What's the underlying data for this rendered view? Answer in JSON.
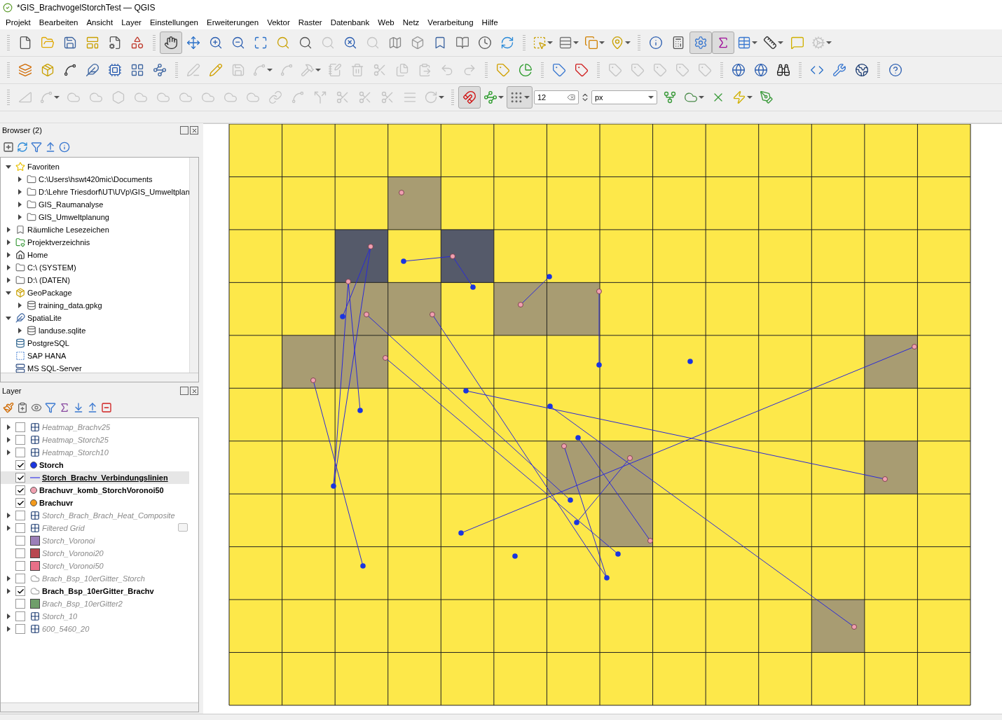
{
  "window": {
    "title": "*GIS_BrachvogelStorchTest — QGIS"
  },
  "menu": [
    "Projekt",
    "Bearbeiten",
    "Ansicht",
    "Layer",
    "Einstellungen",
    "Erweiterungen",
    "Vektor",
    "Raster",
    "Datenbank",
    "Web",
    "Netz",
    "Verarbeitung",
    "Hilfe"
  ],
  "snapping": {
    "tolerance": "12",
    "unit": "px"
  },
  "browser": {
    "title": "Browser (2)",
    "items": [
      {
        "label": "Favoriten",
        "kind": "star",
        "expandable": true,
        "expanded": true,
        "children": [
          {
            "label": "C:\\Users\\hswt420mic\\Documents",
            "kind": "folder",
            "expandable": true,
            "expanded": false
          },
          {
            "label": "D:\\Lehre Triesdorf\\UT\\UVp\\GIS_Umweltplan",
            "kind": "folder",
            "expandable": true,
            "expanded": false
          },
          {
            "label": "GIS_Raumanalyse",
            "kind": "folder",
            "expandable": true,
            "expanded": false
          },
          {
            "label": "GIS_Umweltplanung",
            "kind": "folder",
            "expandable": true,
            "expanded": false
          }
        ]
      },
      {
        "label": "Räumliche Lesezeichen",
        "kind": "bookmark",
        "expandable": true,
        "expanded": false
      },
      {
        "label": "Projektverzeichnis",
        "kind": "project",
        "expandable": true,
        "expanded": false
      },
      {
        "label": "Home",
        "kind": "home",
        "expandable": true,
        "expanded": false
      },
      {
        "label": "C:\\ (SYSTEM)",
        "kind": "folder",
        "expandable": true,
        "expanded": false
      },
      {
        "label": "D:\\ (DATEN)",
        "kind": "folder",
        "expandable": true,
        "expanded": false
      },
      {
        "label": "GeoPackage",
        "kind": "geopackage",
        "expandable": true,
        "expanded": true,
        "children": [
          {
            "label": "training_data.gpkg",
            "kind": "database",
            "expandable": true,
            "expanded": false
          }
        ]
      },
      {
        "label": "SpatiaLite",
        "kind": "spatialite",
        "expandable": true,
        "expanded": true,
        "children": [
          {
            "label": "landuse.sqlite",
            "kind": "database",
            "expandable": true,
            "expanded": false
          }
        ]
      },
      {
        "label": "PostgreSQL",
        "kind": "postgres",
        "expandable": false
      },
      {
        "label": "SAP HANA",
        "kind": "hana",
        "expandable": false
      },
      {
        "label": "MS SQL-Server",
        "kind": "mssql",
        "expandable": false
      }
    ]
  },
  "layers": {
    "title": "Layer",
    "items": [
      {
        "label": "Heatmap_Brachv25",
        "kind": "raster",
        "checked": false,
        "expandable": true,
        "selected": false,
        "filtered": false
      },
      {
        "label": "Heatmap_Storch25",
        "kind": "raster",
        "checked": false,
        "expandable": true,
        "selected": false,
        "filtered": false
      },
      {
        "label": "Heatmap_Storch10",
        "kind": "raster",
        "checked": false,
        "expandable": true,
        "selected": false,
        "filtered": false
      },
      {
        "label": "Storch",
        "kind": "point",
        "color": "#1a35e0",
        "checked": true,
        "expandable": false,
        "selected": false,
        "filtered": false
      },
      {
        "label": "Storch_Brachv_Verbindungslinien",
        "kind": "line",
        "color": "#7f7fe8",
        "checked": true,
        "expandable": false,
        "selected": true,
        "filtered": false
      },
      {
        "label": "Brachuvr_komb_StorchVoronoi50",
        "kind": "point",
        "color": "#f0a0b0",
        "checked": true,
        "expandable": false,
        "selected": false,
        "filtered": false
      },
      {
        "label": "Brachuvr",
        "kind": "point",
        "color": "#f39a1c",
        "checked": true,
        "expandable": false,
        "selected": false,
        "filtered": false
      },
      {
        "label": "Storch_Brach_Brach_Heat_Composite",
        "kind": "raster",
        "checked": false,
        "expandable": true,
        "selected": false,
        "filtered": false
      },
      {
        "label": "Filtered Grid",
        "kind": "raster",
        "checked": false,
        "expandable": true,
        "selected": false,
        "filtered": true
      },
      {
        "label": "Storch_Voronoi",
        "kind": "fill",
        "color": "#9b7fb8",
        "checked": false,
        "expandable": false,
        "selected": false,
        "filtered": false
      },
      {
        "label": "Storch_Voronoi20",
        "kind": "fill",
        "color": "#b8474f",
        "checked": false,
        "expandable": false,
        "selected": false,
        "filtered": false
      },
      {
        "label": "Storch_Voronoi50",
        "kind": "fill",
        "color": "#e87088",
        "checked": false,
        "expandable": false,
        "selected": false,
        "filtered": false
      },
      {
        "label": "Brach_Bsp_10erGitter_Storch",
        "kind": "outline",
        "checked": false,
        "expandable": true,
        "selected": false,
        "filtered": false
      },
      {
        "label": "Brach_Bsp_10erGitter_Brachv",
        "kind": "outline",
        "checked": true,
        "expandable": true,
        "selected": false,
        "filtered": false
      },
      {
        "label": "Brach_Bsp_10erGitter2",
        "kind": "fill",
        "color": "#6f9e6a",
        "checked": false,
        "expandable": false,
        "selected": false,
        "filtered": false
      },
      {
        "label": "Storch_10",
        "kind": "raster",
        "checked": false,
        "expandable": true,
        "selected": false,
        "filtered": false
      },
      {
        "label": "600_5460_20",
        "kind": "raster",
        "checked": false,
        "expandable": true,
        "selected": false,
        "filtered": false
      }
    ]
  }
}
